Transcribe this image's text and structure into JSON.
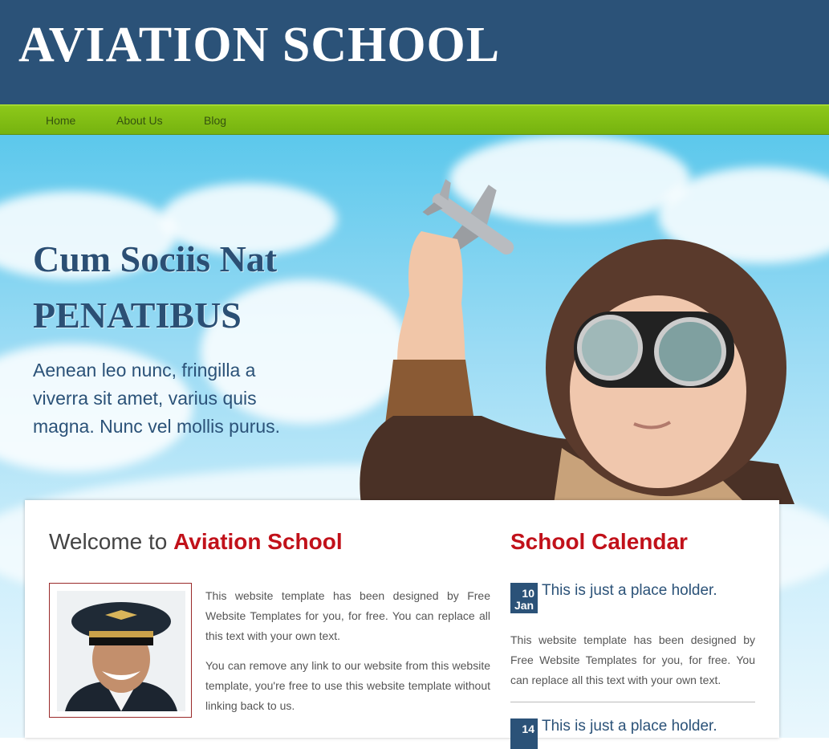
{
  "header": {
    "logo": "AVIATION SCHOOL",
    "bg_color": "#2b5278"
  },
  "nav": {
    "items": [
      {
        "label": "Home"
      },
      {
        "label": "About Us"
      },
      {
        "label": "Blog"
      }
    ],
    "bg_color": "#7fbc14"
  },
  "hero": {
    "title_line1": "Cum Sociis Nat",
    "title_line2": "PENATIBUS",
    "text": "Aenean leo nunc, fringilla a viverra sit amet, varius quis magna. Nunc vel mollis purus."
  },
  "welcome": {
    "heading_prefix": "Welcome to ",
    "heading_highlight": "Aviation School",
    "paragraphs": [
      "This website template has been designed by Free Website Templates for you, for free. You can replace all this text with your own text.",
      "You can remove any link to our website from this website template, you're free to use this website template without linking back to us."
    ]
  },
  "calendar": {
    "title": "School Calendar",
    "events": [
      {
        "day": "10",
        "month": "Jan",
        "title": "This is just a place holder.",
        "description": "This website template has been designed by Free Website Templates for you, for free. You can replace all this text with your own text."
      },
      {
        "day": "14",
        "month": "",
        "title": "This is just a place holder."
      }
    ]
  },
  "colors": {
    "accent_red": "#c1111a",
    "navy": "#2b5278",
    "green": "#7fbc14"
  }
}
